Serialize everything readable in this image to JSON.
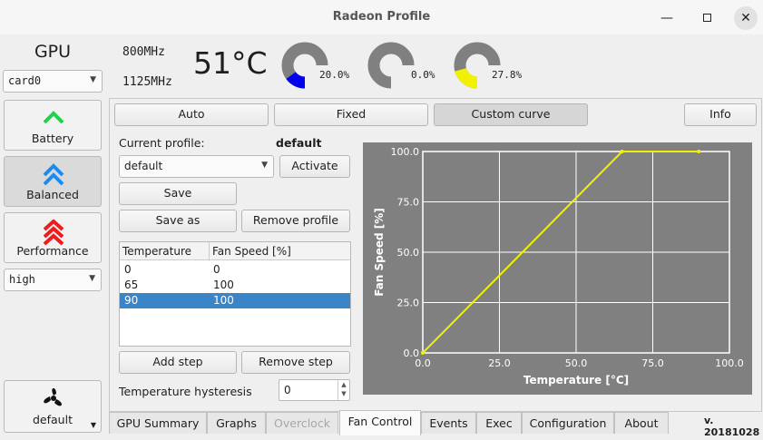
{
  "window": {
    "title": "Radeon Profile"
  },
  "gpu": {
    "label": "GPU",
    "card": "card0",
    "core_clock": "800MHz",
    "mem_clock": "1125MHz",
    "temperature": "51°C"
  },
  "gauges": [
    {
      "name": "gauge-1",
      "value": 20.0,
      "label": "20.0%",
      "color": "#0000ee"
    },
    {
      "name": "gauge-2",
      "value": 0.0,
      "label": "0.0%",
      "color": "#808080"
    },
    {
      "name": "gauge-3",
      "value": 27.8,
      "label": "27.8%",
      "color": "#f2f200"
    }
  ],
  "profiles": {
    "battery": "Battery",
    "balanced": "Balanced",
    "performance": "Performance",
    "level": "high",
    "fan_profile": "default"
  },
  "modes": {
    "auto": "Auto",
    "fixed": "Fixed",
    "custom": "Custom curve",
    "info": "Info"
  },
  "profile_editor": {
    "current_label": "Current profile:",
    "current_value": "default",
    "combo_value": "default",
    "activate": "Activate",
    "save": "Save",
    "save_as": "Save as",
    "remove_profile": "Remove profile"
  },
  "table": {
    "headers": [
      "Temperature",
      "Fan Speed [%]"
    ],
    "rows": [
      {
        "temp": "0",
        "speed": "0"
      },
      {
        "temp": "65",
        "speed": "100"
      },
      {
        "temp": "90",
        "speed": "100"
      }
    ],
    "selected_row": 2
  },
  "steps": {
    "add": "Add step",
    "remove": "Remove step"
  },
  "hysteresis": {
    "label": "Temperature hysteresis",
    "value": "0"
  },
  "chart_data": {
    "type": "line",
    "title": "",
    "xlabel": "Temperature [°C]",
    "ylabel": "Fan Speed [%]",
    "xlim": [
      0,
      100
    ],
    "ylim": [
      0,
      100
    ],
    "x_ticks": [
      "0.0",
      "25.0",
      "50.0",
      "75.0",
      "100.0"
    ],
    "y_ticks": [
      "0.0",
      "25.0",
      "50.0",
      "75.0",
      "100.0"
    ],
    "grid": true,
    "series": [
      {
        "color": "#f2f200",
        "points": [
          [
            0,
            0
          ],
          [
            65,
            100
          ],
          [
            90,
            100
          ]
        ]
      }
    ]
  },
  "tabs": [
    "GPU Summary",
    "Graphs",
    "Overclock",
    "Fan Control",
    "Events",
    "Exec",
    "Configuration",
    "About"
  ],
  "version": "v. 20181028"
}
